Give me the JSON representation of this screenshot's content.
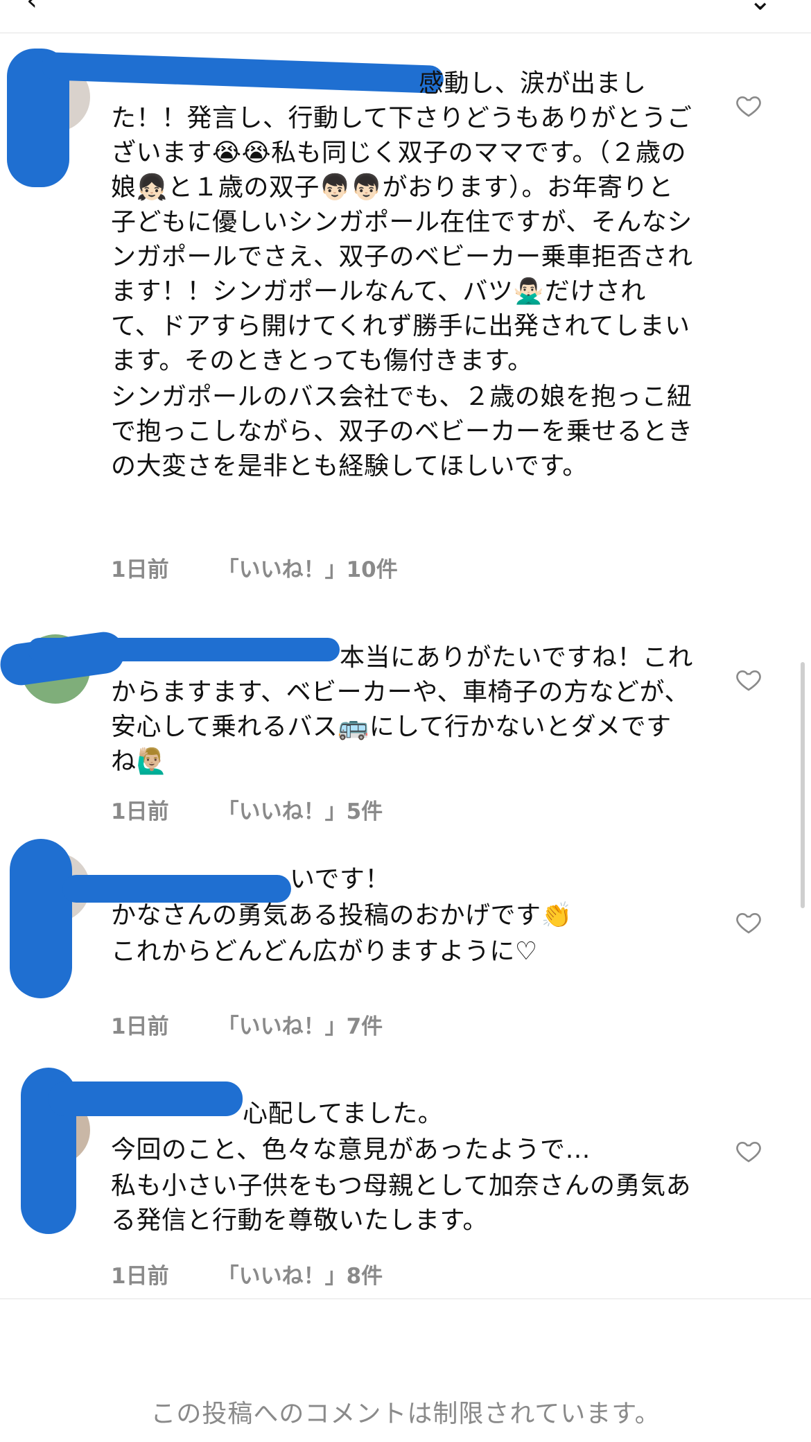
{
  "header": {
    "back_glyph": "‹",
    "menu_glyph": "⌄"
  },
  "comments": [
    {
      "lines": [
        "感動し、涙が出ました！！発言し、行動して下さりどうもありがとうございます😭😭私も同じく双子のママです。（２歳の娘👧🏻と１歳の双子👦🏻👦🏻がおります）。お年寄りと子どもに優しいシンガポール在住ですが、そんなシンガポールでさえ、双子のベビーカー乗車拒否されます！！シンガポールなんて、バツ🙅🏻‍♂️だけされて、ドアすら開けてくれず勝手に出発されてしまいます。そのときとっても傷付きます。",
        "シンガポールのバス会社でも、２歳の娘を抱っこ紐で抱っこしながら、双子のベビーカーを乗せるときの大変さを是非とも経験してほしいです。"
      ],
      "time": "1日前",
      "likes": "「いいね！」10件"
    },
    {
      "lines": [
        "本当にありがたいですね！これからますます、ベビーカーや、車椅子の方などが、安心して乗れるバス🚌にして行かないとダメですね🙋🏼‍♂️"
      ],
      "time": "1日前",
      "likes": "「いいね！」5件"
    },
    {
      "lines": [
        "いです！",
        "かなさんの勇気ある投稿のおかげです👏",
        "これからどんどん広がりますように♡"
      ],
      "time": "1日前",
      "likes": "「いいね！」7件"
    },
    {
      "lines": [
        "心配してました。",
        "今回のこと、色々な意見があったようで…",
        "私も小さい子供をもつ母親として加奈さんの勇気ある発信と行動を尊敬いたします。"
      ],
      "time": "1日前",
      "likes": "「いいね！」8件"
    }
  ],
  "footer": {
    "restricted_notice": "この投稿へのコメントは制限されています。"
  },
  "colors": {
    "redaction": "#1f6fd1",
    "meta_gray": "#8a8a8a"
  },
  "icons": {
    "like": "heart-outline-icon",
    "back": "chevron-left-icon",
    "menu": "chevron-down-icon"
  }
}
